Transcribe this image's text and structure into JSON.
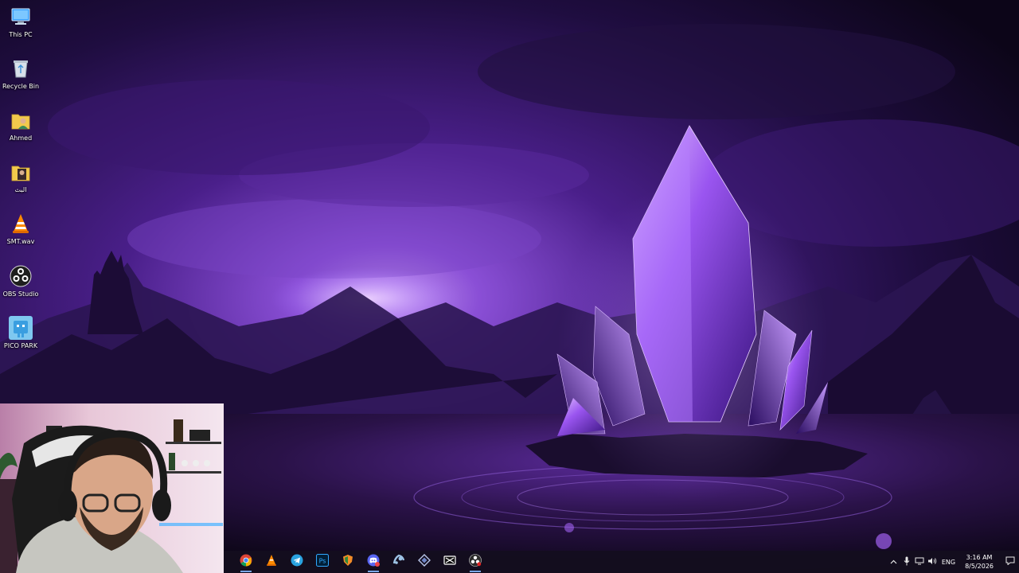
{
  "desktop": {
    "icons": [
      {
        "label": "This PC",
        "icon": "computer-icon"
      },
      {
        "label": "Recycle Bin",
        "icon": "recycle-bin-icon"
      },
      {
        "label": "Ahmed",
        "icon": "user-folder-icon"
      },
      {
        "label": "البث",
        "icon": "folder-image-icon"
      },
      {
        "label": "SMT.wav",
        "icon": "vlc-icon"
      },
      {
        "label": "OBS Studio",
        "icon": "obs-icon"
      },
      {
        "label": "PICO PARK",
        "icon": "pico-park-icon"
      }
    ]
  },
  "taskbar": {
    "apps": [
      {
        "name": "Google Chrome",
        "icon": "chrome-icon",
        "running": true
      },
      {
        "name": "VLC",
        "icon": "vlc-icon",
        "running": false
      },
      {
        "name": "Telegram",
        "icon": "telegram-icon",
        "running": false
      },
      {
        "name": "Photoshop",
        "icon": "photoshop-icon",
        "running": false
      },
      {
        "name": "App",
        "icon": "shield-app-icon",
        "running": false
      },
      {
        "name": "Discord",
        "icon": "discord-icon",
        "running": true
      },
      {
        "name": "Steam",
        "icon": "steam-icon",
        "running": false
      },
      {
        "name": "App",
        "icon": "diamond-app-icon",
        "running": false
      },
      {
        "name": "CapCut",
        "icon": "capcut-icon",
        "running": false
      },
      {
        "name": "OBS Studio",
        "icon": "obs-icon",
        "running": true
      }
    ],
    "tray": {
      "language": "ENG",
      "time": "3:16 AM",
      "date": "8/5/2026"
    }
  },
  "colors": {
    "accent": "#7aa7e8",
    "wallpaper_primary": "#6a2fc2",
    "crystal": "#b06cff"
  }
}
